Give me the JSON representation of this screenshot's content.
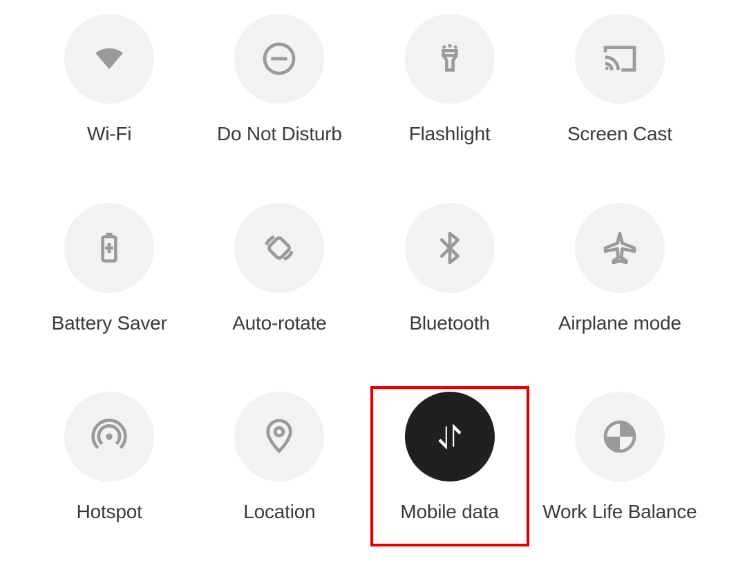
{
  "tiles": [
    {
      "key": "wifi",
      "label": "Wi-Fi",
      "icon": "wifi-icon",
      "active": false,
      "highlighted": false
    },
    {
      "key": "dnd",
      "label": "Do Not Disturb",
      "icon": "dnd-icon",
      "active": false,
      "highlighted": false
    },
    {
      "key": "flashlight",
      "label": "Flashlight",
      "icon": "flashlight-icon",
      "active": false,
      "highlighted": false
    },
    {
      "key": "screencast",
      "label": "Screen Cast",
      "icon": "cast-icon",
      "active": false,
      "highlighted": false
    },
    {
      "key": "battery",
      "label": "Battery Saver",
      "icon": "battery-icon",
      "active": false,
      "highlighted": false
    },
    {
      "key": "autorotate",
      "label": "Auto-rotate",
      "icon": "rotate-icon",
      "active": false,
      "highlighted": false
    },
    {
      "key": "bluetooth",
      "label": "Bluetooth",
      "icon": "bluetooth-icon",
      "active": false,
      "highlighted": false
    },
    {
      "key": "airplane",
      "label": "Airplane mode",
      "icon": "airplane-icon",
      "active": false,
      "highlighted": false
    },
    {
      "key": "hotspot",
      "label": "Hotspot",
      "icon": "hotspot-icon",
      "active": false,
      "highlighted": false
    },
    {
      "key": "location",
      "label": "Location",
      "icon": "location-icon",
      "active": false,
      "highlighted": false
    },
    {
      "key": "mobiledata",
      "label": "Mobile data",
      "icon": "data-icon",
      "active": true,
      "highlighted": true
    },
    {
      "key": "worklife",
      "label": "Work Life Balance",
      "icon": "globe-icon",
      "active": false,
      "highlighted": false
    }
  ],
  "colors": {
    "inactive_bg": "#f2f2f2",
    "active_bg": "#202020",
    "icon": "#9a9a9a",
    "icon_active": "#ffffff",
    "label": "#3a3a3a",
    "highlight": "#e10000"
  }
}
